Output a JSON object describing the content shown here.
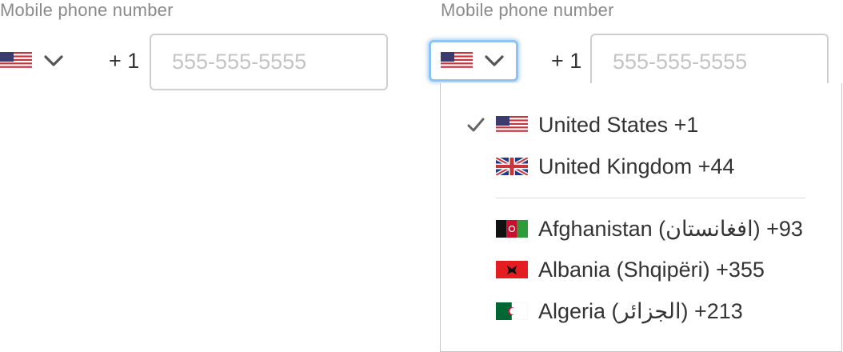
{
  "left_field": {
    "label": "Mobile phone number",
    "dial_code": "+ 1",
    "phone_placeholder": "555-555-5555",
    "phone_value": ""
  },
  "right_field": {
    "label": "Mobile phone number",
    "dial_code": "+ 1",
    "phone_placeholder": "555-555-5555",
    "phone_value": ""
  },
  "dropdown": {
    "preferred": [
      {
        "label": "United States +1",
        "flag": "us-flag-icon",
        "selected": true
      },
      {
        "label": "United Kingdom +44",
        "flag": "uk-flag-icon",
        "selected": false
      }
    ],
    "countries": [
      {
        "label": "Afghanistan (‫افغانستان‬‎) +93",
        "flag": "af-flag-icon"
      },
      {
        "label": "Albania (Shqipëri) +355",
        "flag": "al-flag-icon"
      },
      {
        "label": "Algeria (‫الجزائر‬‎) +213",
        "flag": "dz-flag-icon"
      }
    ]
  },
  "colors": {
    "focus_ring": "#8fc3f5",
    "label_gray": "#8a8a8a",
    "border_gray": "#cfcfcf"
  }
}
